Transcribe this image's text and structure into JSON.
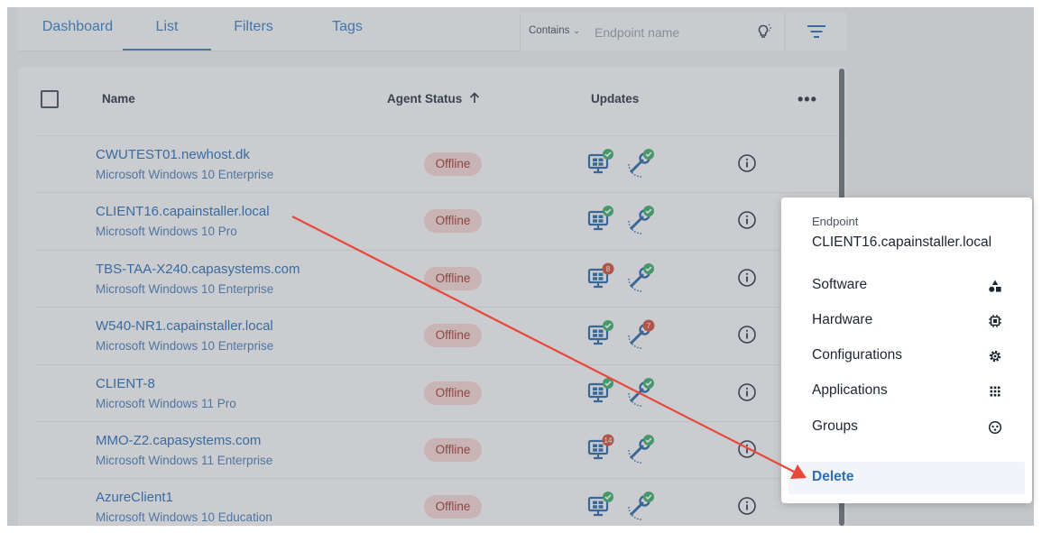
{
  "tabs": [
    {
      "label": "Dashboard",
      "active": false
    },
    {
      "label": "List",
      "active": true
    },
    {
      "label": "Filters",
      "active": false
    },
    {
      "label": "Tags",
      "active": false
    }
  ],
  "search": {
    "mode_label": "Contains",
    "placeholder": "Endpoint name",
    "value": ""
  },
  "table": {
    "headers": {
      "name": "Name",
      "agent_status": "Agent Status",
      "updates": "Updates"
    },
    "sort": {
      "column": "agent_status",
      "direction": "asc"
    },
    "rows": [
      {
        "name": "CWUTEST01.newhost.dk",
        "os": "Microsoft Windows 10 Enterprise",
        "status": "Offline",
        "win_updates": "ok",
        "win_count": "",
        "app_updates": "ok",
        "app_count": ""
      },
      {
        "name": "CLIENT16.capainstaller.local",
        "os": "Microsoft Windows 10 Pro",
        "status": "Offline",
        "win_updates": "ok",
        "win_count": "",
        "app_updates": "ok",
        "app_count": ""
      },
      {
        "name": "TBS-TAA-X240.capasystems.com",
        "os": "Microsoft Windows 10 Enterprise",
        "status": "Offline",
        "win_updates": "count",
        "win_count": "8",
        "app_updates": "ok",
        "app_count": ""
      },
      {
        "name": "W540-NR1.capainstaller.local",
        "os": "Microsoft Windows 10 Enterprise",
        "status": "Offline",
        "win_updates": "ok",
        "win_count": "",
        "app_updates": "count",
        "app_count": "7"
      },
      {
        "name": "CLIENT-8",
        "os": "Microsoft Windows 11 Pro",
        "status": "Offline",
        "win_updates": "ok",
        "win_count": "",
        "app_updates": "ok",
        "app_count": ""
      },
      {
        "name": "MMO-Z2.capasystems.com",
        "os": "Microsoft Windows 11 Enterprise",
        "status": "Offline",
        "win_updates": "count",
        "win_count": "14",
        "app_updates": "ok",
        "app_count": ""
      },
      {
        "name": "AzureClient1",
        "os": "Microsoft Windows 10 Education",
        "status": "Offline",
        "win_updates": "ok",
        "win_count": "",
        "app_updates": "ok",
        "app_count": ""
      }
    ]
  },
  "context_menu": {
    "kicker": "Endpoint",
    "title": "CLIENT16.capainstaller.local",
    "items": [
      {
        "label": "Software",
        "icon": "shapes-icon"
      },
      {
        "label": "Hardware",
        "icon": "chip-icon"
      },
      {
        "label": "Configurations",
        "icon": "gear-icon"
      },
      {
        "label": "Applications",
        "icon": "grid-icon"
      },
      {
        "label": "Groups",
        "icon": "group-icon"
      }
    ],
    "delete_label": "Delete"
  },
  "colors": {
    "accent": "#2d6fb6",
    "offline_bg": "#f3d4d2",
    "offline_text": "#a53a36",
    "ok_badge": "#3fae6b",
    "count_badge": "#d2533d",
    "annotation_arrow": "#e8473a"
  }
}
